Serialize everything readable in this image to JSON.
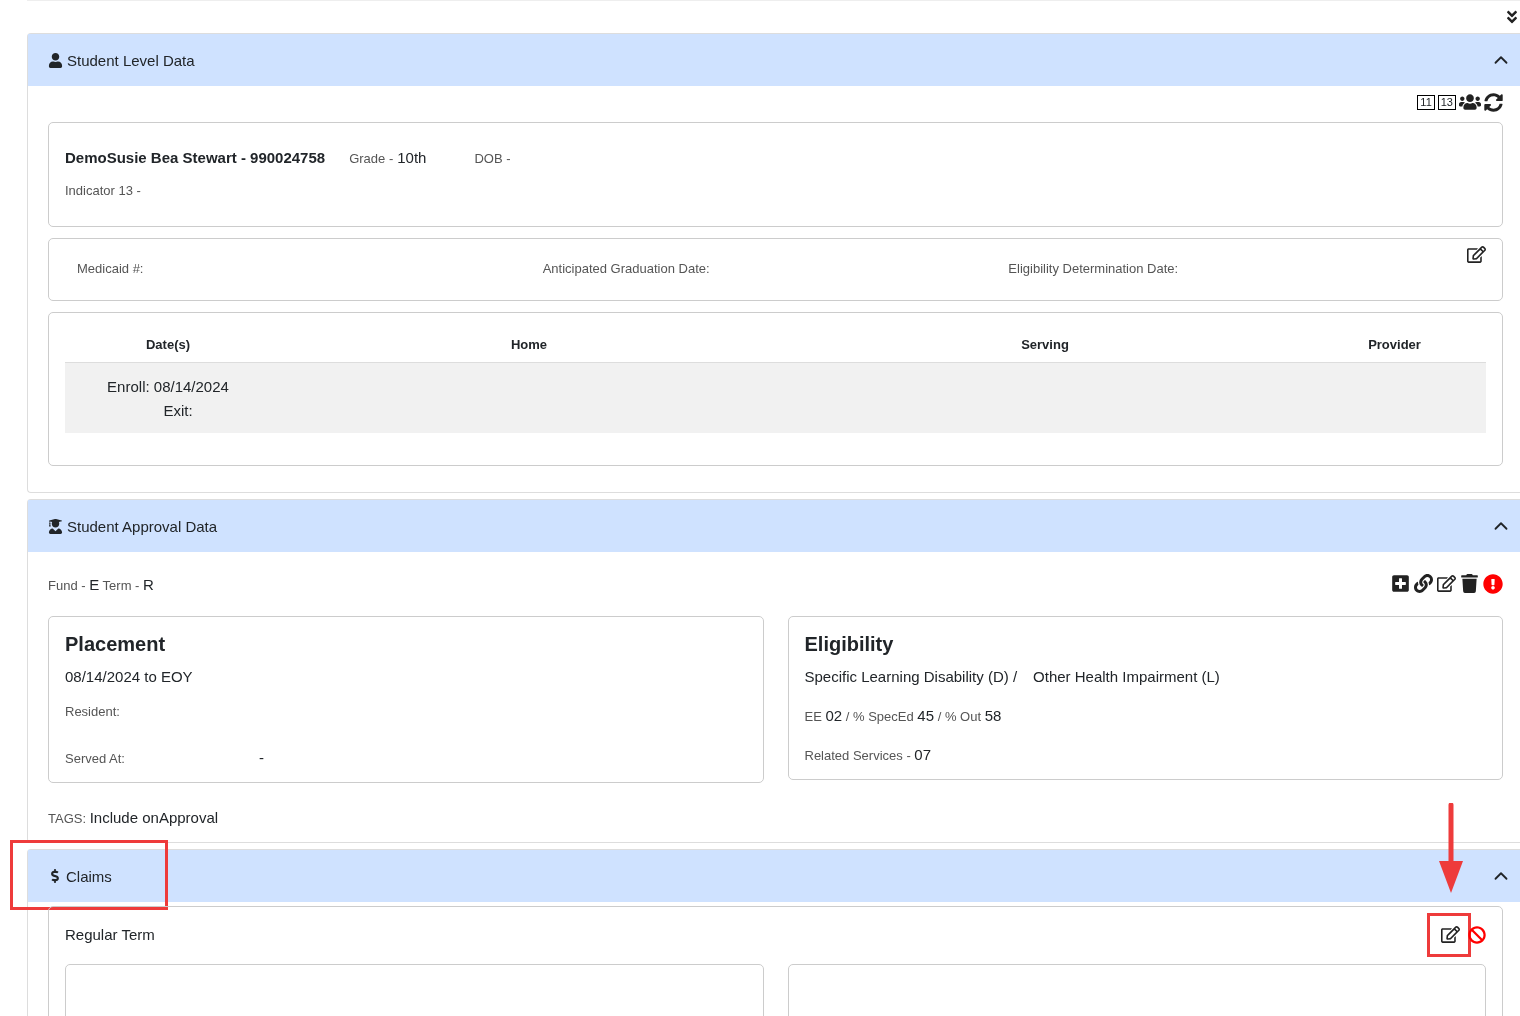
{
  "student_level": {
    "title": "Student Level Data",
    "expanded": true,
    "toolbar": [
      "11",
      "13"
    ],
    "student": {
      "name": "DemoSusie Bea Stewart - 990024758",
      "grade_label": "Grade -",
      "grade": "10th",
      "dob_label": "DOB -",
      "indicator_label": "Indicator 13 -"
    },
    "details": [
      "Medicaid #:",
      "Anticipated Graduation Date:",
      "Eligibility Determination Date:"
    ],
    "enrollment": {
      "columns": [
        "Date(s)",
        "Home",
        "Serving",
        "Provider"
      ],
      "rows": [
        {
          "enroll": "Enroll: 08/14/2024",
          "exit": "Exit:"
        }
      ]
    }
  },
  "approval": {
    "title": "Student Approval Data",
    "expanded": true,
    "fund_label": "Fund -",
    "fund": "E",
    "term_label": "Term -",
    "term": "R",
    "placement": {
      "title": "Placement",
      "dates": "08/14/2024 to EOY",
      "resident_label": "Resident:",
      "served_label": "Served At:",
      "served_value": "-"
    },
    "eligibility": {
      "title": "Eligibility",
      "disabilities": [
        "Specific Learning Disability (D) /",
        "Other Health Impairment (L)"
      ],
      "ee_label": "EE",
      "ee": "02",
      "sped_label": "/ % SpecEd",
      "sped": "45",
      "out_label": "/ % Out",
      "out": "58",
      "related_label": "Related Services -",
      "related": "07"
    },
    "tags_label": "TAGS:",
    "tags": "Include onApproval"
  },
  "claims": {
    "title": "Claims",
    "expanded": true,
    "term": "Regular Term"
  },
  "annotations": {
    "highlight_claims_header": true,
    "highlight_edit_button": true
  }
}
